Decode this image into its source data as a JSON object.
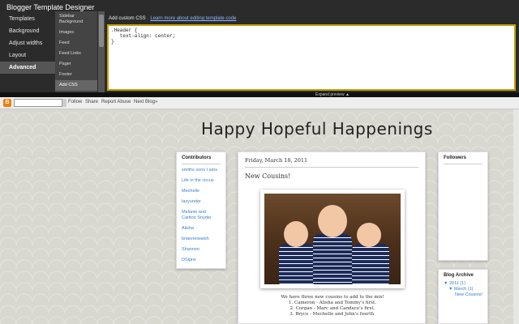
{
  "designer": {
    "title": "Blogger Template Designer",
    "main_nav": [
      "Templates",
      "Background",
      "Adjust widths",
      "Layout",
      "Advanced"
    ],
    "sub_nav": [
      "Sidebar Background",
      "Images",
      "Feed",
      "Feed Links",
      "Pager",
      "Footer",
      "Add CSS"
    ],
    "css_label": "Add custom CSS",
    "css_help_link": "Learn more about editing template code",
    "css_code": ".Header {\n   text-align: center;\n}",
    "preview_label": "Expand preview ▲"
  },
  "navbar": {
    "logo": "B",
    "links": [
      "Follow",
      "Share",
      "Report Abuse",
      "Next Blog»"
    ]
  },
  "blog": {
    "title": "Happy Hopeful Happenings",
    "contributors_title": "Contributors",
    "contributors": [
      "smiths sons I ams",
      "Life in the circus",
      "Mechelle",
      "lazyunder",
      "Melanie and Carlton Snyder",
      "Alisha",
      "brianneiwalsh",
      "Shannon",
      "DSigns"
    ],
    "post_date": "Friday, March 18, 2011",
    "post_title": "New Cousins!",
    "post_lines": [
      "We have three new cousins to add to the mix!",
      "1. Cameron - Alisha and Tommy's first.",
      "2. Corgan - Marc and Candace's first.",
      "3. Bryce - Mechelle and John's fourth."
    ],
    "followers_title": "Followers",
    "archive_title": "Blog Archive",
    "archive": [
      "▼  2011 (1)",
      "▼  March (1)",
      "New Cousins!"
    ]
  },
  "colors": {
    "accent_link": "#3a7dc9",
    "editor_border": "#c8a000",
    "logo": "#f57d00"
  }
}
